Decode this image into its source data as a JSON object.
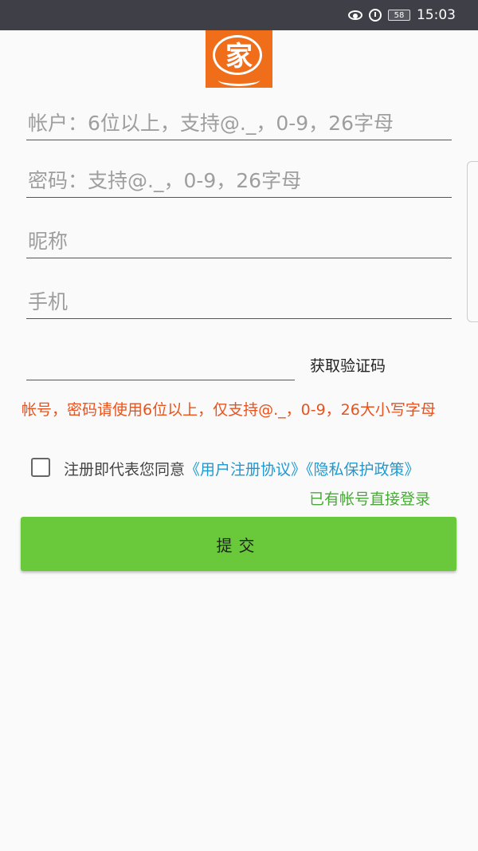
{
  "status_bar": {
    "battery": "58",
    "time": "15:03"
  },
  "logo": {
    "char": "家"
  },
  "fields": {
    "account_placeholder": "帐户：6位以上，支持@._，0-9，26字母",
    "password_placeholder": "密码：支持@._，0-9，26字母",
    "nickname_placeholder": "昵称",
    "phone_placeholder": "手机"
  },
  "verify": {
    "button_label": "获取验证码"
  },
  "hint": "帐号，密码请使用6位以上，仅支持@._，0-9，26大小写字母",
  "agreement": {
    "text": "注册即代表您同意",
    "user_agreement": "《用户注册协议》",
    "privacy_policy": "《隐私保护政策》"
  },
  "login_link": "已有帐号直接登录",
  "submit_label": "提交",
  "colors": {
    "logo_bg": "#f06d1a",
    "button": "#6ac93b",
    "hint": "#e8531d",
    "link": "#1b9bd3",
    "login": "#4aa83a"
  }
}
